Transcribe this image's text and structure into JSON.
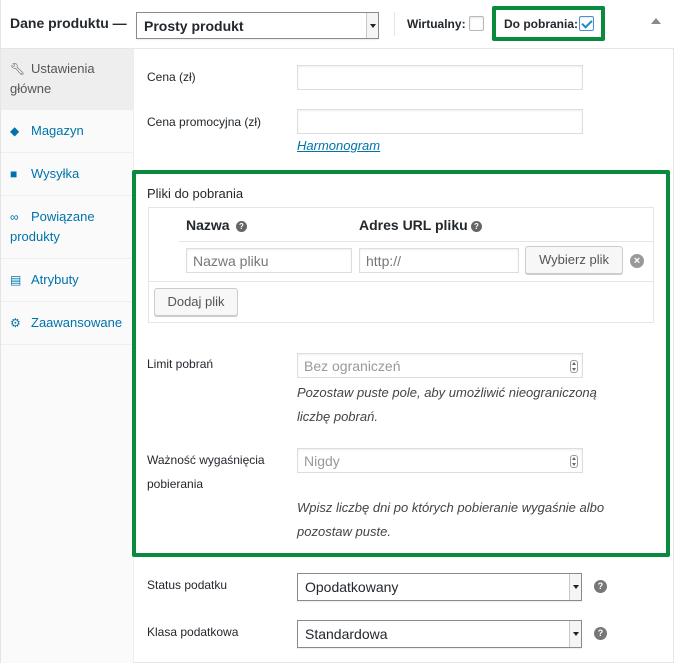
{
  "header": {
    "title": "Dane produktu —",
    "product_type": "Prosty produkt",
    "virtual_label": "Wirtualny:",
    "virtual_checked": false,
    "downloadable_label": "Do pobrania:",
    "downloadable_checked": true
  },
  "sidebar": {
    "items": [
      {
        "label": "Ustawienia główne",
        "icon": "wrench-icon",
        "active": true
      },
      {
        "label": "Magazyn",
        "icon": "tag-icon",
        "active": false
      },
      {
        "label": "Wysyłka",
        "icon": "truck-icon",
        "active": false
      },
      {
        "label": "Powiązane produkty",
        "icon": "link-icon",
        "active": false
      },
      {
        "label": "Atrybuty",
        "icon": "list-icon",
        "active": false
      },
      {
        "label": "Zaawansowane",
        "icon": "gear-icon",
        "active": false
      }
    ]
  },
  "pricing": {
    "price_label": "Cena (zł)",
    "sale_price_label": "Cena promocyjna (zł)",
    "schedule_link": "Harmonogram"
  },
  "downloads": {
    "title": "Pliki do pobrania",
    "col_name": "Nazwa",
    "col_url": "Adres URL pliku",
    "name_placeholder": "Nazwa pliku",
    "url_placeholder": "http://",
    "choose_file": "Wybierz plik",
    "add_file": "Dodaj plik",
    "limit_label": "Limit pobrań",
    "limit_placeholder": "Bez ograniczeń",
    "limit_desc_1": "Pozostaw puste pole, aby umożliwić nieograniczoną",
    "limit_desc_2": "liczbę pobrań.",
    "expiry_label_1": "Ważność wygaśnięcia",
    "expiry_label_2": "pobierania",
    "expiry_placeholder": "Nigdy",
    "expiry_desc_1": "Wpisz liczbę dni po których pobieranie wygaśnie albo",
    "expiry_desc_2": "pozostaw puste."
  },
  "tax": {
    "status_label": "Status podatku",
    "status_value": "Opodatkowany",
    "class_label": "Klasa podatkowa",
    "class_value": "Standardowa"
  },
  "colors": {
    "highlight": "#0a8a3d",
    "link": "#0073aa"
  }
}
